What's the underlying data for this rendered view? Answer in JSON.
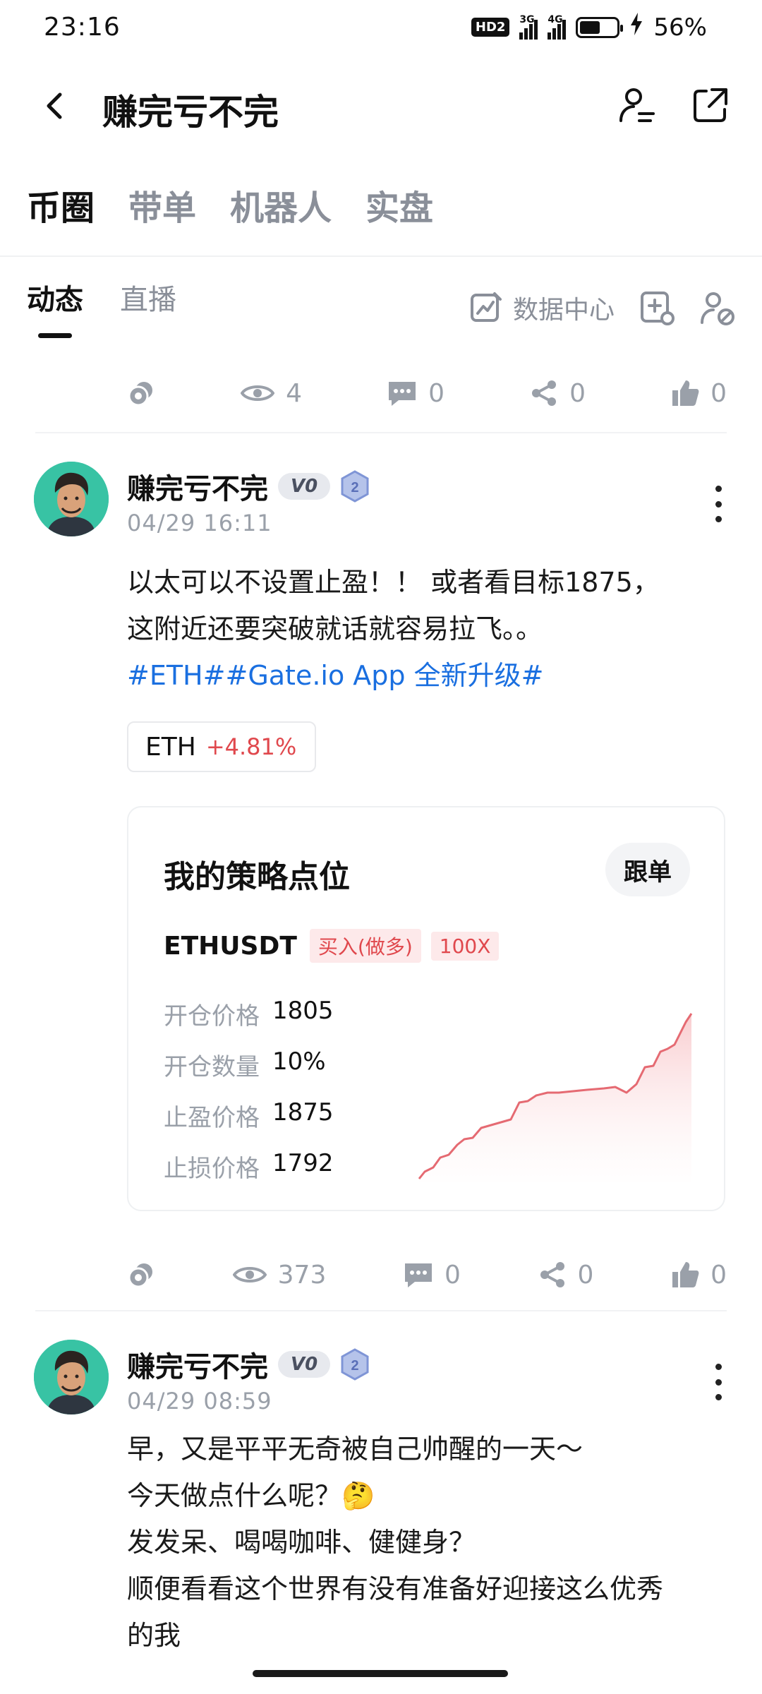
{
  "status_bar": {
    "time": "23:16",
    "hd": "HD2",
    "net1": "3G",
    "net2": "4G",
    "battery_level": 0.56,
    "battery_percent": "56%"
  },
  "header": {
    "title": "赚完亏不完"
  },
  "main_tabs": [
    {
      "label": "币圈"
    },
    {
      "label": "带单"
    },
    {
      "label": "机器人"
    },
    {
      "label": "实盘"
    }
  ],
  "sub_tabs": [
    {
      "label": "动态"
    },
    {
      "label": "直播"
    }
  ],
  "data_center_label": "数据中心",
  "prev_stats": {
    "views": "4",
    "comments": "0",
    "shares": "0",
    "likes": "0"
  },
  "posts": [
    {
      "author": "赚完亏不完",
      "vip": "V0",
      "level": "2",
      "time": "04/29 16:11",
      "text_line1": "以太可以不设置止盈！！ 或者看目标1875，",
      "text_line2": "这附近还要突破就话就容易拉飞。。",
      "tags": "#ETH##Gate.io App 全新升级#",
      "coin": {
        "name": "ETH",
        "change": "+4.81%"
      },
      "strategy": {
        "title": "我的策略点位",
        "follow_label": "跟单",
        "pair": "ETHUSDT",
        "side": "买入(做多)",
        "leverage": "100X",
        "rows": [
          {
            "k": "开仓价格",
            "v": "1805"
          },
          {
            "k": "开仓数量",
            "v": "10%"
          },
          {
            "k": "止盈价格",
            "v": "1875"
          },
          {
            "k": "止损价格",
            "v": "1792"
          }
        ]
      },
      "stats": {
        "views": "373",
        "comments": "0",
        "shares": "0",
        "likes": "0"
      }
    },
    {
      "author": "赚完亏不完",
      "vip": "V0",
      "level": "2",
      "time": "04/29 08:59",
      "lines": [
        "早，又是平平无奇被自己帅醒的一天～",
        "今天做点什么呢？🤔",
        "发发呆、喝喝咖啡、健健身？",
        "顺便看看这个世界有没有准备好迎接这么优秀",
        "的我"
      ]
    }
  ],
  "colors": {
    "accent_red": "#e0484d",
    "link_blue": "#1a6fe0",
    "muted": "#9aa0a9",
    "avatar_bg": "#38c3a4"
  },
  "icons": [
    "back-arrow-icon",
    "user-edit-icon",
    "share-external-icon",
    "chart-edit-icon",
    "add-settings-icon",
    "user-block-icon",
    "tip-coin-icon",
    "eye-icon",
    "comment-icon",
    "share-icon",
    "thumbs-up-icon",
    "more-vertical-icon"
  ]
}
